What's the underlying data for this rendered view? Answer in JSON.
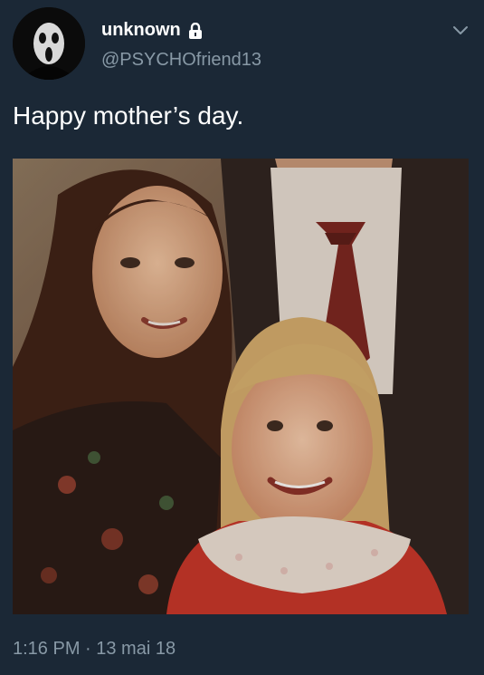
{
  "tweet": {
    "author": {
      "display_name": "unknown",
      "handle": "@PSYCHOfriend13",
      "protected": true,
      "avatar_icon": "ghostface-mask-avatar"
    },
    "text": "Happy mother’s day.",
    "media": {
      "type": "photo",
      "alt": "vintage family portrait"
    },
    "timestamp": "1:16 PM · 13 mai 18",
    "menu_icon": "chevron-down-icon"
  },
  "colors": {
    "background": "#1b2836",
    "text_primary": "#ffffff",
    "text_secondary": "#8899a6"
  }
}
